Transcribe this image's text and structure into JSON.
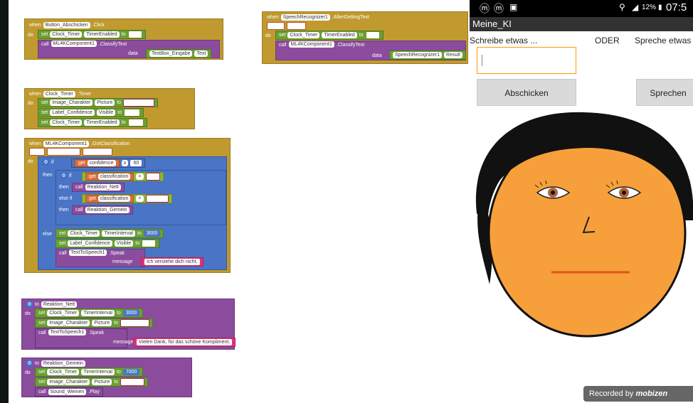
{
  "blocks": {
    "button_click": {
      "when": "when",
      "component": "Button_Abschicken",
      "event": ".Click",
      "do": "do",
      "set": "set",
      "to": "to",
      "timer": "Clock_Timer",
      "prop": "TimerEnabled",
      "bool_true": "true",
      "call": "call",
      "ml": "ML4KComponent1",
      "method": ".ClassifyText",
      "data": "data",
      "textbox": "TextBox_Eingabe",
      "textprop": "Text"
    },
    "speech": {
      "when": "when",
      "component": "SpeechRecognizer1",
      "event": ".AfterGettingText",
      "param1": "result",
      "param2": "partial",
      "do": "do",
      "set": "set",
      "to": "to",
      "timer": "Clock_Timer",
      "prop": "TimerEnabled",
      "bool_true": "true",
      "call": "call",
      "ml": "ML4KComponent1",
      "method": ".ClassifyText",
      "data": "data",
      "recog": "SpeechRecognizer1",
      "recogprop": "Result"
    },
    "timer": {
      "when": "when",
      "component": "Clock_Timer",
      "event": ".Timer",
      "do": "do",
      "set": "set",
      "to": "to",
      "img": "Image_Charakter",
      "imgprop": "Picture",
      "imgval": "Neutral.png",
      "label": "Label_Confidence",
      "labelprop": "Visible",
      "labelval": "false",
      "timer": "Clock_Timer",
      "timerprop": "TimerEnabled",
      "timerval": "false"
    },
    "classification": {
      "when": "when",
      "component": "ML4KComponent1",
      "event": ".GotClassification",
      "data": "data",
      "p1": "classification",
      "p2": "confidence",
      "do": "do",
      "if": "if",
      "get": "get",
      "confidence": "confidence",
      "op_ge": "≥",
      "threshold": "60",
      "then": "then",
      "classification": "classification",
      "op_eq": "=",
      "nett": "Nett",
      "call": "call",
      "reaktion_nett": "Reaktion_Nett",
      "else_if": "else if",
      "gemein": "Gemein",
      "reaktion_gemein": "Reaktion_Gemein",
      "else": "else",
      "set": "set",
      "to": "to",
      "timer": "Clock_Timer",
      "timerprop": "TimerInterval",
      "interval": "3000",
      "label": "Label_Confidence",
      "labelprop": "Visible",
      "labelval": "true",
      "tts": "TextToSpeech1",
      "speak": ".Speak",
      "message": "message",
      "msg": "Ich verstehe dich nicht."
    },
    "nett": {
      "to": "to",
      "name": "Reaktion_Nett",
      "do": "do",
      "set": "set",
      "timer": "Clock_Timer",
      "timerprop": "TimerInterval",
      "interval": "3000",
      "img": "Image_Charakter",
      "imgprop": "Picture",
      "imgval": "Happy.png",
      "call": "call",
      "tts": "TextToSpeech1",
      "speak": ".Speak",
      "message": "message",
      "msg": "Vielen Dank, für das schöne Kompliment."
    },
    "gemein": {
      "to": "to",
      "name": "Reaktion_Gemein",
      "do": "do",
      "set": "set",
      "timer": "Clock_Timer",
      "timerprop": "TimerInterval",
      "interval": "7000",
      "img": "Image_Charakter",
      "imgprop": "Picture",
      "imgval": "Sad.png",
      "call": "call",
      "sound": "Sound_Weinen",
      "play": ".Play"
    }
  },
  "phone": {
    "status_time": "07:5",
    "battery": "12%",
    "app_title": "Meine_KI",
    "label_write": "Schreibe etwas ...",
    "label_or": "ODER",
    "label_speak": "Spreche etwas",
    "textbox_value": "",
    "btn_send": "Abschicken",
    "btn_speak": "Sprechen",
    "recorded": "Recorded by",
    "recorded_brand": "mobizen"
  },
  "colors": {
    "event": "#c09a2f",
    "setter": "#6aa032",
    "call": "#8b4c9e",
    "control": "#4a74c5",
    "get": "#de6b3c",
    "text": "#e0317a",
    "logic": "#8fba2f",
    "textbox_border": "#ff9800"
  }
}
